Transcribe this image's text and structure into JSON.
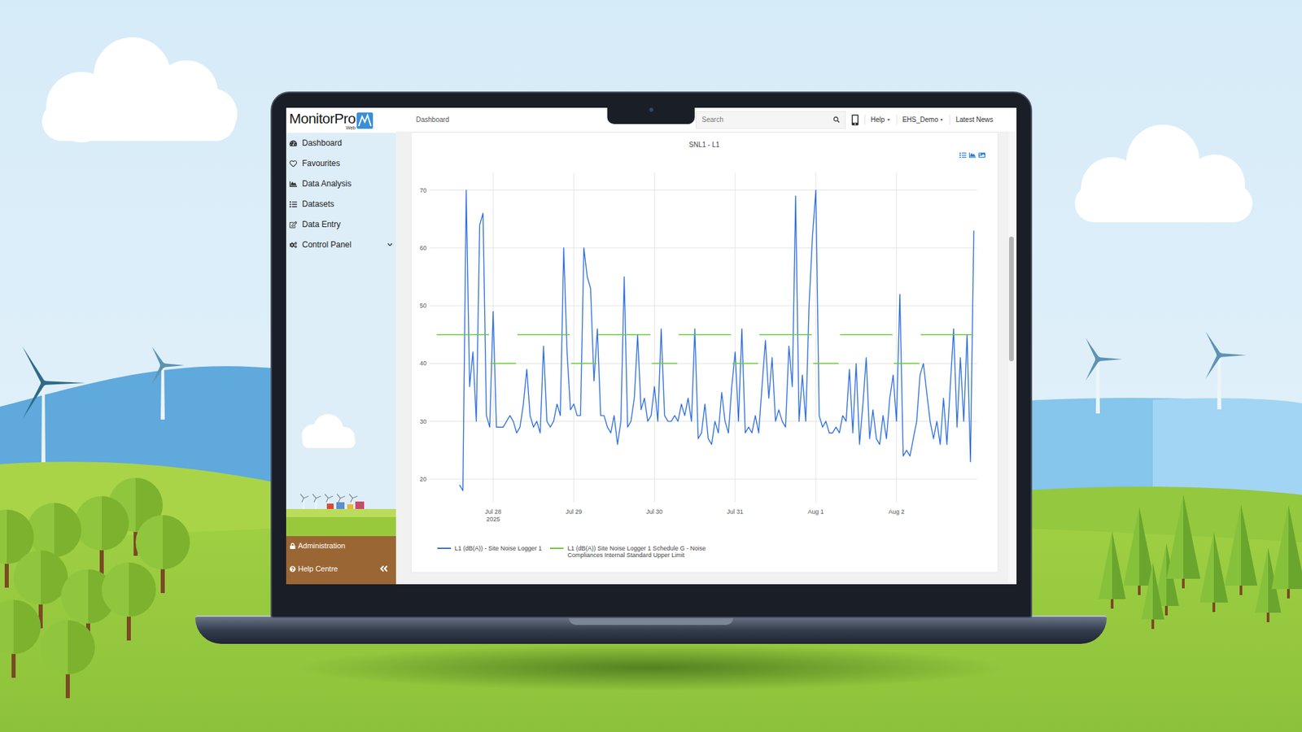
{
  "app": {
    "name": "MonitorPro",
    "edition": "Web"
  },
  "sidebar": {
    "items": [
      {
        "label": "Dashboard",
        "selected": false,
        "expandable": false,
        "expanded": false
      },
      {
        "label": "Favourites",
        "selected": false,
        "expandable": false,
        "expanded": false
      },
      {
        "label": "Data Analysis",
        "selected": false,
        "expandable": false,
        "expanded": false
      },
      {
        "label": "Datasets",
        "selected": false,
        "expandable": false,
        "expanded": false
      },
      {
        "label": "Data Entry",
        "selected": false,
        "expandable": false,
        "expanded": false
      },
      {
        "label": "Control Panel",
        "selected": false,
        "expandable": true,
        "expanded": false
      }
    ],
    "footer": [
      {
        "label": "Administration"
      },
      {
        "label": "Help Centre"
      }
    ]
  },
  "topbar": {
    "breadcrumb": "Dashboard",
    "search": {
      "placeholder": "Search"
    },
    "menus": [
      {
        "label": "Help",
        "dropdown": true
      },
      {
        "label": "EHS_Demo",
        "dropdown": true
      },
      {
        "label": "Latest News",
        "dropdown": false
      }
    ]
  },
  "chart": {
    "title": "SNL1 - L1",
    "y_axis": {
      "min": 16,
      "max": 73,
      "ticks": [
        {
          "label": "20",
          "value": 20
        },
        {
          "label": "30",
          "value": 30
        },
        {
          "label": "40",
          "value": 40
        },
        {
          "label": "50",
          "value": 50
        },
        {
          "label": "60",
          "value": 60
        },
        {
          "label": "70",
          "value": 70
        }
      ]
    },
    "x_axis": {
      "min": 5,
      "max": 168,
      "ticks": [
        {
          "label": "Jul 28",
          "sub": "2025",
          "hour": 24
        },
        {
          "label": "Jul 29",
          "sub": "",
          "hour": 48
        },
        {
          "label": "Jul 30",
          "sub": "",
          "hour": 72
        },
        {
          "label": "Jul 31",
          "sub": "",
          "hour": 96
        },
        {
          "label": "Aug 1",
          "sub": "",
          "hour": 120
        },
        {
          "label": "Aug 2",
          "sub": "",
          "hour": 144
        }
      ]
    },
    "series": [
      {
        "name": "L1 (dB(A)) - Site Noise Logger 1",
        "kind": "line",
        "color": "#2f6fe0",
        "start_hour": 14,
        "step_hours": 1,
        "values": [
          19,
          18,
          70,
          36,
          42,
          30,
          64,
          66,
          31,
          29,
          49,
          29,
          29,
          29,
          30,
          31,
          30,
          28,
          29,
          33,
          39,
          31,
          29,
          30,
          28,
          43,
          30,
          29,
          30,
          33,
          31,
          60,
          42,
          32,
          33,
          31,
          31,
          60,
          55,
          53,
          37,
          46,
          31,
          31,
          29,
          28,
          31,
          26,
          30,
          55,
          29,
          30,
          34,
          45,
          32,
          34,
          30,
          31,
          36,
          30,
          46,
          31,
          30,
          30,
          31,
          30,
          33,
          31,
          34,
          30,
          46,
          27,
          28,
          33,
          27,
          26,
          30,
          28,
          35,
          30,
          28,
          36,
          42,
          30,
          46,
          28,
          29,
          28,
          31,
          28,
          36,
          44,
          34,
          41,
          30,
          32,
          30,
          29,
          43,
          36,
          69,
          30,
          38,
          30,
          50,
          62,
          70,
          31,
          29,
          30,
          28,
          28,
          29,
          28,
          31,
          30,
          39,
          28,
          40,
          26,
          33,
          41,
          27,
          32,
          27,
          26,
          31,
          27,
          34,
          38,
          30,
          52,
          24,
          25,
          24,
          27,
          30,
          38,
          40,
          35,
          30,
          27,
          30,
          26,
          34,
          26,
          36,
          46,
          29,
          41,
          30,
          45,
          23,
          63
        ]
      },
      {
        "name": "L1 (dB(A)) Site Noise Logger 1 Schedule G - Noise Compliances Internal Standard Upper Limit",
        "kind": "steps",
        "color": "#66cc33",
        "segments": [
          {
            "from": 7,
            "to": 23,
            "value": 45
          },
          {
            "from": 23,
            "to": 31,
            "value": 40
          },
          {
            "from": 31,
            "to": 47,
            "value": 45
          },
          {
            "from": 47,
            "to": 55,
            "value": 40
          },
          {
            "from": 55,
            "to": 71,
            "value": 45
          },
          {
            "from": 71,
            "to": 79,
            "value": 40
          },
          {
            "from": 79,
            "to": 95,
            "value": 45
          },
          {
            "from": 95,
            "to": 103,
            "value": 40
          },
          {
            "from": 103,
            "to": 119,
            "value": 45
          },
          {
            "from": 119,
            "to": 127,
            "value": 40
          },
          {
            "from": 127,
            "to": 143,
            "value": 45
          },
          {
            "from": 143,
            "to": 151,
            "value": 40
          },
          {
            "from": 151,
            "to": 167,
            "value": 45
          }
        ]
      }
    ]
  }
}
